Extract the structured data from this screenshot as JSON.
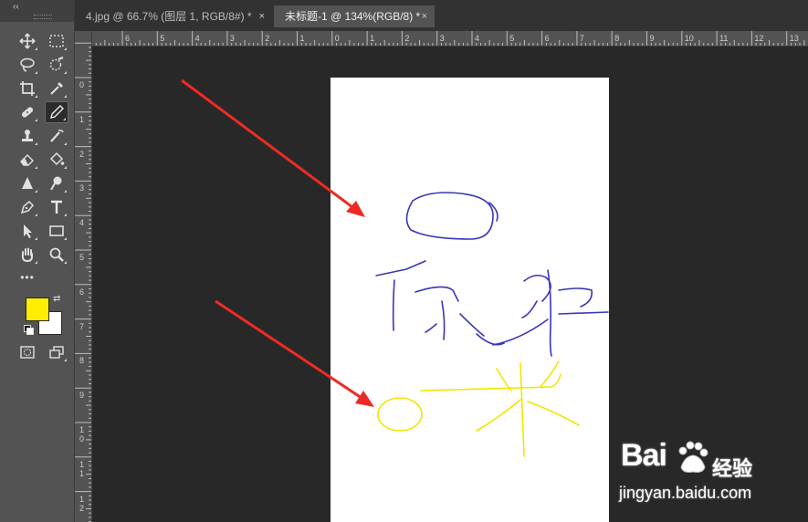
{
  "tabs": [
    {
      "title": "4.jpg @ 66.7% (图层 1, RGB/8#) *",
      "close": "×"
    },
    {
      "title": "未标题-1 @ 134%(RGB/8) *",
      "close": "×"
    }
  ],
  "toolbar": {
    "collapse": "‹‹",
    "tools": [
      "move-tool",
      "marquee-tool",
      "lasso-tool",
      "quick-select-tool",
      "crop-tool",
      "eyedropper-tool",
      "healing-brush-tool",
      "brush-tool",
      "clone-stamp-tool",
      "history-brush-tool",
      "eraser-tool",
      "paint-bucket-tool",
      "blur-tool",
      "dodge-tool",
      "pen-tool",
      "type-tool",
      "path-select-tool",
      "rectangle-tool",
      "hand-tool",
      "zoom-tool"
    ],
    "active_tool": "brush-tool",
    "more": "•••"
  },
  "colors": {
    "foreground": "#ffee00",
    "background": "#ffffff",
    "stroke_blue": "#3a36b8",
    "stroke_yellow": "#f2e600",
    "arrow_red": "#ee2a24"
  },
  "ruler_top_labels": [
    "6",
    "5",
    "4",
    "3",
    "2",
    "1",
    "0",
    "1",
    "2",
    "3",
    "4",
    "5",
    "6",
    "7",
    "8",
    "9",
    "10",
    "11",
    "12",
    "13"
  ],
  "ruler_left_labels": [
    "0",
    "1",
    "2",
    "3",
    "4",
    "5",
    "6",
    "7",
    "8",
    "9",
    "10",
    "11",
    "12"
  ],
  "watermark": {
    "brand": "Bai",
    "brand_end": "经验",
    "url": "jingyan.baidu.com"
  }
}
